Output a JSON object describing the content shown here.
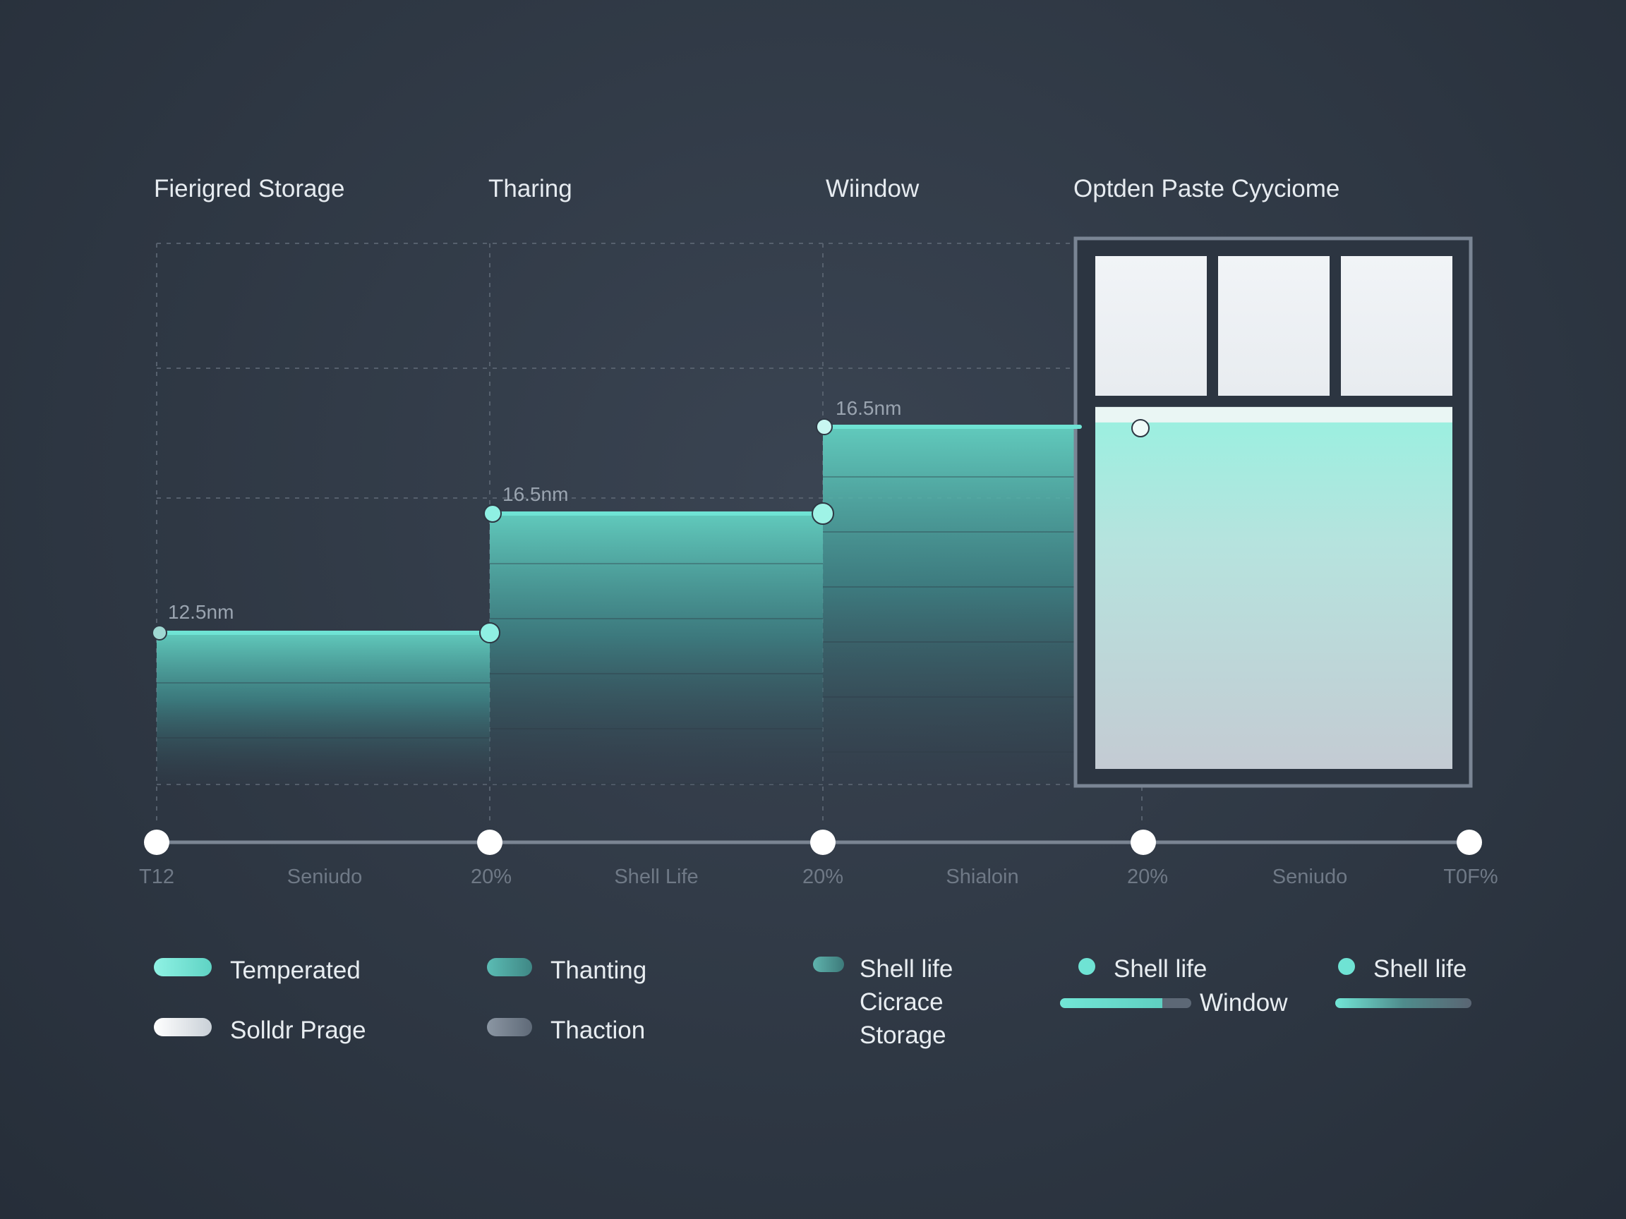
{
  "colors": {
    "teal": "#6fe3d4",
    "teal_bright": "#7ef1e2",
    "panel_border": "#7a8594",
    "axis": "#7b8593",
    "grid": "#56606d",
    "background": "#2e3743"
  },
  "phase_titles": [
    "Fierigred Storage",
    "Tharing",
    "Wiindow",
    "Optden Paste Cyyciome"
  ],
  "chart_data": {
    "type": "area",
    "step": true,
    "title": "",
    "xlabel": "",
    "ylabel": "",
    "ylim": [
      0,
      20
    ],
    "grid": true,
    "legend_position": "bottom",
    "x_ticks": [
      "T12",
      "Seniudo",
      "20%",
      "Shell Life",
      "20%",
      "Shialoin",
      "20%",
      "Seniudo",
      "T0F%"
    ],
    "segments": [
      {
        "value": 12.5,
        "label": "12.5nm"
      },
      {
        "value": 16.5,
        "label": "16.5nm"
      },
      {
        "value": 18.5,
        "label": "16.5nm"
      }
    ],
    "panel": {
      "label": "Optden Paste Cyyciome",
      "value": 18.6,
      "thumbnails": 3
    }
  },
  "legend": [
    {
      "label": "Temperated",
      "style": "swatch",
      "color": "#6fe3d4"
    },
    {
      "label": "Thanting",
      "style": "swatch",
      "color": "#4fa8a3"
    },
    {
      "label": "Shell life\nCicrace\nStorage",
      "style": "swatch",
      "color": "#4f9895"
    },
    {
      "label": "Shell life",
      "style": "dot",
      "color": "#6fe3d4"
    },
    {
      "label": "Shell life",
      "style": "dot",
      "color": "#6fe3d4"
    },
    {
      "label": "Solldr Prage",
      "style": "swatch",
      "color": "#eef1f4"
    },
    {
      "label": "Thaction",
      "style": "swatch",
      "color": "#6f7b89"
    },
    {
      "label": "Window",
      "style": "bar",
      "color": "#6fe3d4"
    }
  ]
}
